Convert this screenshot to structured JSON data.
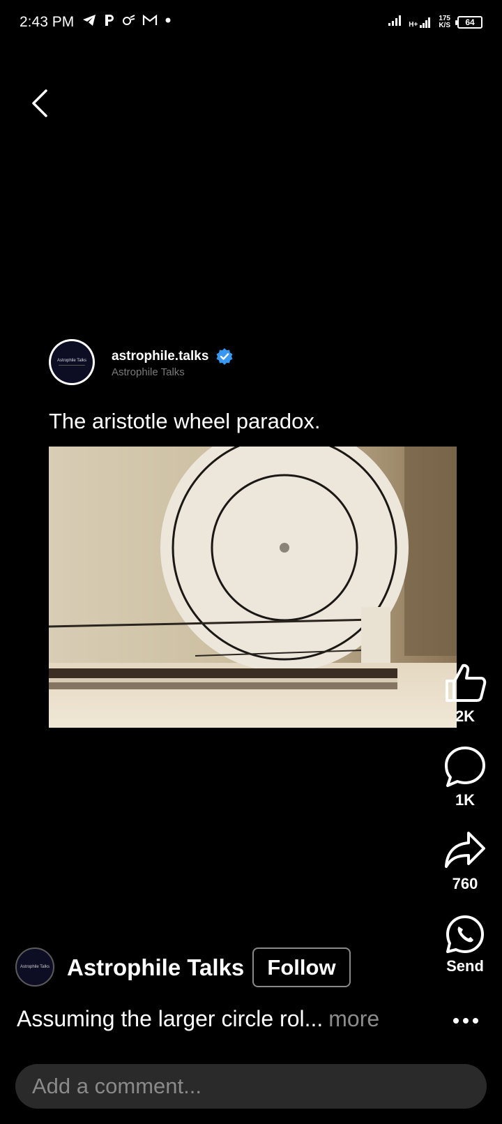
{
  "status_bar": {
    "time": "2:43 PM",
    "left_icons": [
      "telegram-icon",
      "paytm-icon",
      "notification-icon",
      "gmail-icon",
      "dot-icon"
    ],
    "net_speed_value": "175",
    "net_speed_unit": "K/S",
    "battery": "64",
    "network_label": "H+"
  },
  "post": {
    "username": "astrophile.talks",
    "display_name": "Astrophile Talks",
    "verified": true,
    "text": "The aristotle wheel paradox.",
    "avatar_text": "Astrophile Talks"
  },
  "actions": {
    "like_count": "2K",
    "comment_count": "1K",
    "share_count": "760",
    "send_label": "Send"
  },
  "footer": {
    "channel_name": "Astrophile Talks",
    "channel_avatar_text": "Astrophile Talks",
    "follow_label": "Follow",
    "caption": "Assuming the larger circle rol...",
    "more_label": "more",
    "comment_placeholder": "Add a comment..."
  },
  "colors": {
    "background": "#000000",
    "verified_blue": "#3897f0",
    "muted_text": "#8c8c8c",
    "comment_bg": "#2a2a2a"
  }
}
